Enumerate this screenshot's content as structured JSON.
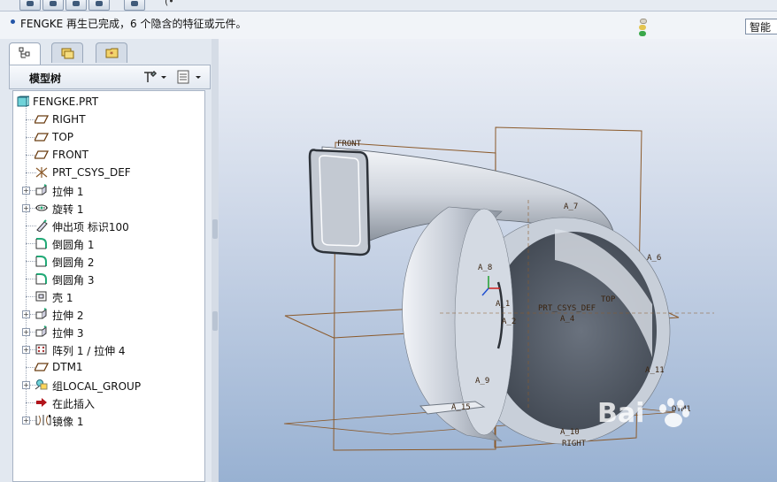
{
  "statusbar": {
    "message": "FENGKE 再生已完成，6 个隐含的特征或元件。",
    "mode_select": "智能"
  },
  "model_tree": {
    "title": "模型树",
    "items": [
      {
        "label": "FENGKE.PRT",
        "icon": "part-icon",
        "expandable": false
      },
      {
        "label": "RIGHT",
        "icon": "datum-plane-icon",
        "expandable": false
      },
      {
        "label": "TOP",
        "icon": "datum-plane-icon",
        "expandable": false
      },
      {
        "label": "FRONT",
        "icon": "datum-plane-icon",
        "expandable": false
      },
      {
        "label": "PRT_CSYS_DEF",
        "icon": "coordinate-system-icon",
        "expandable": false
      },
      {
        "label": "拉伸 1",
        "icon": "extrude-icon",
        "expandable": true
      },
      {
        "label": "旋转 1",
        "icon": "revolve-icon",
        "expandable": true
      },
      {
        "label": "伸出项 标识100",
        "icon": "protrusion-icon",
        "expandable": false
      },
      {
        "label": "倒圆角 1",
        "icon": "round-icon",
        "expandable": false
      },
      {
        "label": "倒圆角 2",
        "icon": "round-icon",
        "expandable": false
      },
      {
        "label": "倒圆角 3",
        "icon": "round-icon",
        "expandable": false
      },
      {
        "label": "壳 1",
        "icon": "shell-icon",
        "expandable": false
      },
      {
        "label": "拉伸 2",
        "icon": "extrude-icon",
        "expandable": true
      },
      {
        "label": "拉伸 3",
        "icon": "extrude-icon",
        "expandable": true
      },
      {
        "label": "阵列 1 / 拉伸 4",
        "icon": "pattern-icon",
        "expandable": true
      },
      {
        "label": "DTM1",
        "icon": "datum-plane-icon",
        "expandable": false
      },
      {
        "label": "组LOCAL_GROUP",
        "icon": "group-icon",
        "expandable": true
      },
      {
        "label": "在此插入",
        "icon": "insert-here-arrow-icon",
        "expandable": false
      },
      {
        "label": "镜像 1",
        "icon": "mirror-icon",
        "expandable": true
      }
    ]
  },
  "viewport": {
    "labels": {
      "front": "FRONT",
      "top": "TOP",
      "right": "RIGHT",
      "dtm1": "DTM1",
      "csys": "PRT_CSYS_DEF",
      "a7": "A_7",
      "a6": "A_6",
      "a8": "A_8",
      "a1": "A_1",
      "a2": "A_2",
      "a4": "A_4",
      "a9": "A_9",
      "a11": "A_11",
      "a10": "A_10",
      "a15": "A_15"
    },
    "watermark": "Bai"
  },
  "colors": {
    "datum": "#8b5a2b",
    "viewport_top": "#eef1f7",
    "viewport_bottom": "#98b1d2",
    "model_light": "#e3e7ee",
    "model_dark": "#4d5562"
  }
}
